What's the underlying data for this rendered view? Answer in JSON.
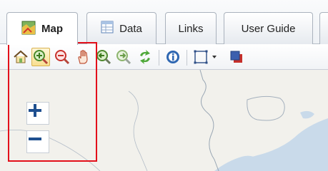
{
  "tabs": [
    {
      "key": "map",
      "label": "Map",
      "active": true
    },
    {
      "key": "data",
      "label": "Data",
      "active": false
    },
    {
      "key": "links",
      "label": "Links",
      "active": false
    },
    {
      "key": "guide",
      "label": "User Guide",
      "active": false
    }
  ],
  "toolbar": {
    "tools": [
      "home-icon",
      "zoom-in-tool-icon",
      "zoom-out-tool-icon",
      "pan-hand-icon",
      "previous-extent-icon",
      "next-extent-icon",
      "refresh-icon",
      "identify-icon",
      "select-rectangle-icon",
      "dropdown-arrow-icon",
      "layers-icon"
    ],
    "active_tool": "zoom-in-tool-icon"
  },
  "map_controls": {
    "zoom_in": "+",
    "zoom_out": "−"
  },
  "colors": {
    "water": "#c9daea",
    "land": "#f2f1ec",
    "accent": "#1e4f8f",
    "highlight": "#e3101a"
  }
}
